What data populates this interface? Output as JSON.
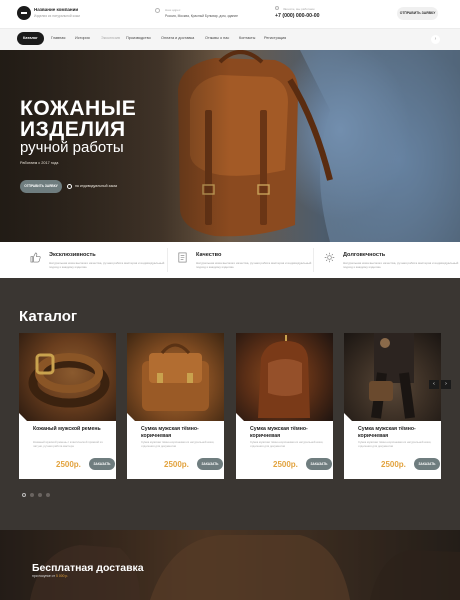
{
  "header": {
    "company_name": "Название компании",
    "company_sub": "Изделия из натуральной кожи",
    "address_label": "Наш адрес",
    "address_value": "Россия, Москва, Красный Бульвар, дом, здание",
    "phone_label": "Звоните, мы работаем",
    "phone_value": "+7 (000) 000-00-00",
    "callback_label": "ОТПРАВИТЬ ЗАЯВКУ"
  },
  "nav": {
    "items": [
      "Каталог",
      "Главная",
      "История",
      "Эксклюзив",
      "Производство",
      "Оплата и доставка",
      "Отзывы о нас",
      "Контакты",
      "Регистрация"
    ],
    "active_index": 0,
    "scroll_icon": "chevron-right-icon"
  },
  "hero": {
    "title_line1": "Кожаные",
    "title_line2": "изделия",
    "subtitle": "ручной работы",
    "since": "Работаем с 2017 года",
    "order_label": "ОТПРАВИТЬ ЗАЯВКУ",
    "note": "на индивидуальный заказ"
  },
  "features": [
    {
      "icon": "thumbs-up-icon",
      "title": "Эксклюзивность",
      "text": "Натуральная кожа высокого качества, ручная работа мастеров и индивидуальный подход к каждому изделию"
    },
    {
      "icon": "document-icon",
      "title": "Качество",
      "text": "Натуральная кожа высокого качества, ручная работа мастеров и индивидуальный подход к каждому изделию"
    },
    {
      "icon": "gear-icon",
      "title": "Долговечность",
      "text": "Натуральная кожа высокого качества, ручная работа мастеров и индивидуальный подход к каждому изделию"
    }
  ],
  "catalog": {
    "title": "Каталог",
    "buy_label": "ЗАКАЗАТЬ",
    "products": [
      {
        "name": "Кожаный мужской ремень",
        "desc": "Кожаный мужской ремень с классической пряжкой из латуни, ручная работа мастера",
        "price": "2500р."
      },
      {
        "name": "Сумка мужская тёмно-коричневая",
        "desc": "Сумка мужская тёмно-коричневая из натуральной кожи, отделения для документов",
        "price": "2500р."
      },
      {
        "name": "Сумка мужская тёмно-коричневая",
        "desc": "Сумка мужская тёмно-коричневая из натуральной кожи, отделения для документов",
        "price": "2500р."
      },
      {
        "name": "Сумка мужская тёмно-коричневая",
        "desc": "Сумка мужская тёмно-коричневая из натуральной кожи, отделения для документов",
        "price": "2500р."
      }
    ],
    "prev_icon": "arrow-left-icon",
    "next_icon": "arrow-right-icon",
    "pages": 4,
    "current_page": 1
  },
  "delivery": {
    "title": "Бесплатная доставка",
    "note_prefix": "при покупке от",
    "note_amount": "5 000 р."
  },
  "colors": {
    "dark": "#1b1b1b",
    "accent_price": "#e2a33f",
    "button": "#6f7d7f",
    "catalog_bg": "#3a3632"
  }
}
